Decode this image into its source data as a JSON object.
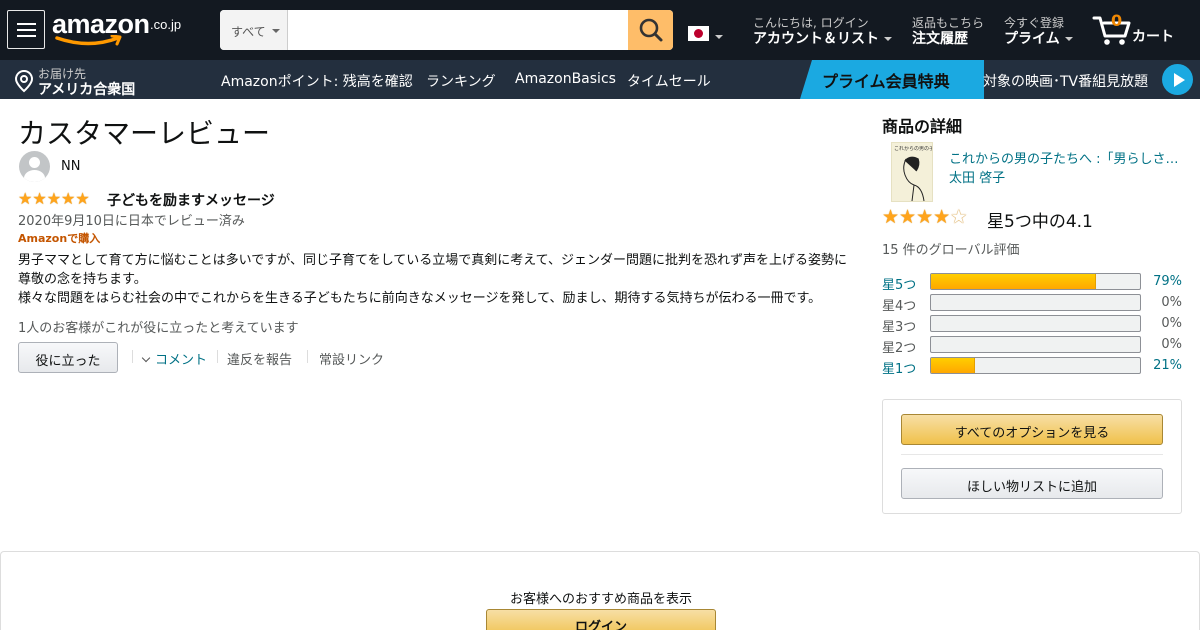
{
  "header": {
    "logo_text": "amazon",
    "logo_tld": ".co.jp",
    "search_category": "すべて",
    "search_placeholder": "",
    "account_greeting": "こんにちは, ログイン",
    "account_label": "アカウント＆リスト",
    "orders_line1": "返品もこちら",
    "orders_line2": "注文履歴",
    "prime_line1": "今すぐ登録",
    "prime_line2": "プライム",
    "cart_count": "0",
    "cart_label": "カート"
  },
  "subnav": {
    "deliver_line1": "お届け先",
    "deliver_line2": "アメリカ合衆国",
    "links": [
      "Amazonポイント: 残高を確認",
      "ランキング",
      "AmazonBasics",
      "タイムセール"
    ],
    "prime_badge": "プライム会員特典",
    "prime_text": "対象の映画･TV番組見放題"
  },
  "review": {
    "page_title": "カスタマーレビュー",
    "reviewer": "NN",
    "rating": 5,
    "headline": "子どもを励ますメッセージ",
    "date": "2020年9月10日に日本でレビュー済み",
    "verified": "Amazonで購入",
    "body_lines": [
      "男子ママとして育て方に悩むことは多いですが、同じ子育てをしている立場で真剣に考えて、ジェンダー問題に批判を恐れず声を上げる姿勢に",
      "尊敬の念を持ちます。",
      "様々な問題をはらむ社会の中でこれからを生きる子どもたちに前向きなメッセージを発して、励まし、期待する気持ちが伝わる一冊です。"
    ],
    "helpful_count_text": "1人のお客様がこれが役に立ったと考えています",
    "helpful_button": "役に立った",
    "comment_link": "コメント",
    "report_link": "違反を報告",
    "permalink": "常設リンク"
  },
  "product": {
    "heading": "商品の詳細",
    "title": "これからの男の子たちへ :「男らしさ」から自由になるためのレッスン",
    "author": "太田 啓子",
    "cover_text": "これからの男の子たちへ",
    "rating_value": 4.1,
    "rating_text": "星5つ中の4.1",
    "global_count": "15 件のグローバル評価",
    "histogram": [
      {
        "label": "星5つ",
        "percent": 79,
        "percent_text": "79%"
      },
      {
        "label": "星4つ",
        "percent": 0,
        "percent_text": "0%"
      },
      {
        "label": "星3つ",
        "percent": 0,
        "percent_text": "0%"
      },
      {
        "label": "星2つ",
        "percent": 0,
        "percent_text": "0%"
      },
      {
        "label": "星1つ",
        "percent": 21,
        "percent_text": "21%"
      }
    ],
    "all_options_button": "すべてのオプションを見る",
    "wishlist_button": "ほしい物リストに追加"
  },
  "signin": {
    "text": "お客様へのおすすめ商品を表示",
    "button": "ログイン"
  },
  "colors": {
    "nav_bg": "#131921",
    "subnav_bg": "#232f3e",
    "link": "#007185",
    "star": "#ffa41c",
    "button_yellow": "#f0c14b",
    "prime_blue": "#1ba9e1",
    "verified_orange": "#c45500"
  },
  "icons": {
    "menu": "hamburger-icon",
    "search": "search-icon",
    "location": "location-pin-icon",
    "cart": "cart-icon",
    "flag": "japan-flag-icon",
    "play": "play-icon"
  }
}
